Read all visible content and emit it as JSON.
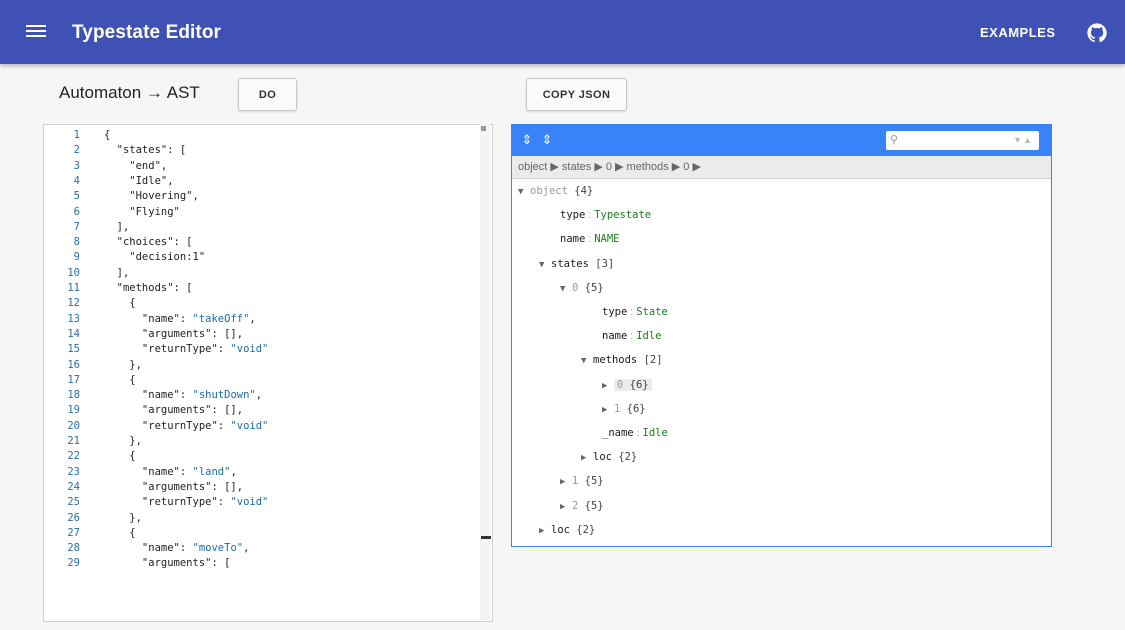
{
  "appbar": {
    "title": "Typestate Editor",
    "examples_label": "EXAMPLES"
  },
  "toolbar": {
    "heading": "Automaton → AST",
    "do_label": "DO",
    "copy_label": "COPY JSON"
  },
  "editor": {
    "lines": [
      {
        "n": "1",
        "t": "{"
      },
      {
        "n": "2",
        "t": "  \"states\": ["
      },
      {
        "n": "3",
        "t": "    \"end\","
      },
      {
        "n": "4",
        "t": "    \"Idle\","
      },
      {
        "n": "5",
        "t": "    \"Hovering\","
      },
      {
        "n": "6",
        "t": "    \"Flying\""
      },
      {
        "n": "7",
        "t": "  ],"
      },
      {
        "n": "8",
        "t": "  \"choices\": ["
      },
      {
        "n": "9",
        "t": "    \"decision:1\""
      },
      {
        "n": "10",
        "t": "  ],"
      },
      {
        "n": "11",
        "t": "  \"methods\": ["
      },
      {
        "n": "12",
        "t": "    {"
      },
      {
        "n": "13",
        "t": "      \"name\": \"takeOff\","
      },
      {
        "n": "14",
        "t": "      \"arguments\": [],"
      },
      {
        "n": "15",
        "t": "      \"returnType\": \"void\""
      },
      {
        "n": "16",
        "t": "    },"
      },
      {
        "n": "17",
        "t": "    {"
      },
      {
        "n": "18",
        "t": "      \"name\": \"shutDown\","
      },
      {
        "n": "19",
        "t": "      \"arguments\": [],"
      },
      {
        "n": "20",
        "t": "      \"returnType\": \"void\""
      },
      {
        "n": "21",
        "t": "    },"
      },
      {
        "n": "22",
        "t": "    {"
      },
      {
        "n": "23",
        "t": "      \"name\": \"land\","
      },
      {
        "n": "24",
        "t": "      \"arguments\": [],"
      },
      {
        "n": "25",
        "t": "      \"returnType\": \"void\""
      },
      {
        "n": "26",
        "t": "    },"
      },
      {
        "n": "27",
        "t": "    {"
      },
      {
        "n": "28",
        "t": "      \"name\": \"moveTo\","
      },
      {
        "n": "29",
        "t": "      \"arguments\": ["
      }
    ]
  },
  "viewer": {
    "path": "object ▶ states ▶ 0 ▶ methods ▶ 0 ▶",
    "nodes": [
      {
        "toggle": "▼",
        "key": "object",
        "count": "{4}",
        "value": "",
        "level": 0,
        "grey": true
      },
      {
        "toggle": "",
        "key": "type",
        "count": "",
        "value": "Typestate",
        "level": 2
      },
      {
        "toggle": "",
        "key": "name",
        "count": "",
        "value": "NAME",
        "level": 2
      },
      {
        "toggle": "▼",
        "key": "states",
        "count": "[3]",
        "value": "",
        "level": 1
      },
      {
        "toggle": "▼",
        "key": "0",
        "count": "{5}",
        "value": "",
        "level": 2,
        "grey": true
      },
      {
        "toggle": "",
        "key": "type",
        "count": "",
        "value": "State",
        "level": 4
      },
      {
        "toggle": "",
        "key": "name",
        "count": "",
        "value": "Idle",
        "level": 4
      },
      {
        "toggle": "▼",
        "key": "methods",
        "count": "[2]",
        "value": "",
        "level": 3
      },
      {
        "toggle": "▶",
        "key": "0",
        "count": "{6}",
        "value": "",
        "level": 4,
        "grey": true,
        "hl": true
      },
      {
        "toggle": "▶",
        "key": "1",
        "count": "{6}",
        "value": "",
        "level": 4,
        "grey": true
      },
      {
        "toggle": "",
        "key": "_name",
        "count": "",
        "value": "Idle",
        "level": 4
      },
      {
        "toggle": "▶",
        "key": "loc",
        "count": "{2}",
        "value": "",
        "level": 3
      },
      {
        "toggle": "▶",
        "key": "1",
        "count": "{5}",
        "value": "",
        "level": 2,
        "grey": true
      },
      {
        "toggle": "▶",
        "key": "2",
        "count": "{5}",
        "value": "",
        "level": 2,
        "grey": true
      },
      {
        "toggle": "▶",
        "key": "loc",
        "count": "{2}",
        "value": "",
        "level": 1
      }
    ],
    "search": {
      "placeholder": ""
    },
    "colors": {
      "accent": "#3883fa",
      "appbar": "#3f51b5"
    }
  }
}
